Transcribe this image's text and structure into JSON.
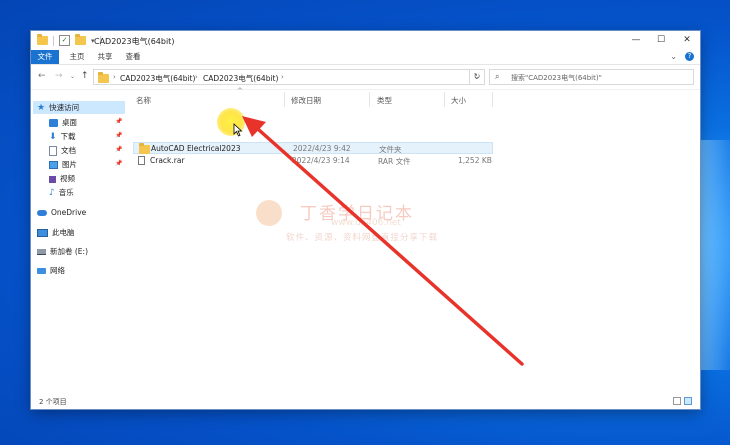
{
  "window": {
    "title": "CAD2023电气(64bit)",
    "controls": {
      "minimize": "—",
      "maximize": "☐",
      "close": "✕"
    }
  },
  "ribbon": {
    "tabs": [
      "文件",
      "主页",
      "共享",
      "查看"
    ]
  },
  "address": {
    "crumbs": [
      "CAD2023电气(64bit)",
      "CAD2023电气(64bit)"
    ],
    "search_placeholder": "搜索\"CAD2023电气(64bit)\""
  },
  "nav": {
    "quick_access": "快速访问",
    "items": [
      {
        "label": "桌面",
        "pinned": true
      },
      {
        "label": "下载",
        "pinned": true
      },
      {
        "label": "文档",
        "pinned": true
      },
      {
        "label": "图片",
        "pinned": true
      },
      {
        "label": "视频",
        "pinned": false
      },
      {
        "label": "音乐",
        "pinned": false
      }
    ],
    "onedrive": "OneDrive",
    "this_pc": "此电脑",
    "new_volume": "新加卷 (E:)",
    "network": "网络"
  },
  "columns": {
    "name": "名称",
    "date": "修改日期",
    "type": "类型",
    "size": "大小"
  },
  "files": [
    {
      "name": "AutoCAD Electrical2023",
      "date": "2022/4/23 9:42",
      "type": "文件夹",
      "size": "",
      "selected": true
    },
    {
      "name": "Crack.rar",
      "date": "2022/4/23 9:14",
      "type": "RAR 文件",
      "size": "1,252 KB",
      "selected": false
    }
  ],
  "status": {
    "count": "2 个项目"
  },
  "watermark": {
    "title": "丁香学日记本",
    "url": "www.dx406.net",
    "subtitle": "软件、资源、资料网盘直接分享下载"
  },
  "colors": {
    "accent": "#1a73d0",
    "arrow": "#e8332a",
    "highlight": "#ffe93c"
  }
}
